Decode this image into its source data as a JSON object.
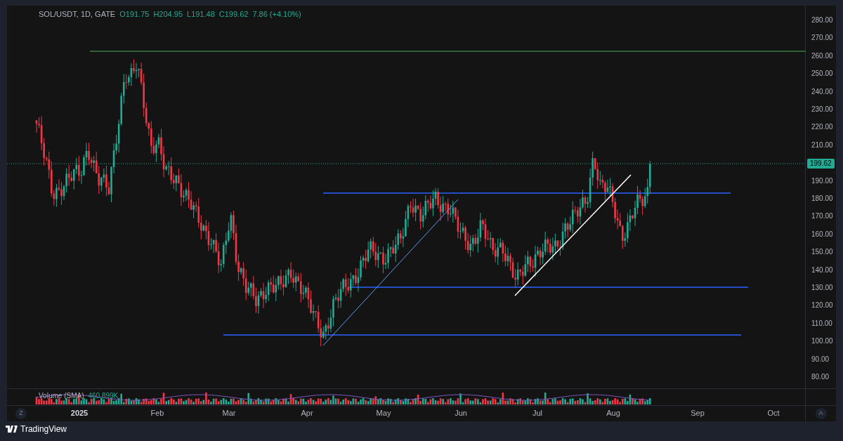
{
  "legend": {
    "symbol": "SOL/USDT, 1D, GATE",
    "open": "O191.75",
    "high": "H204.95",
    "low": "L191.48",
    "close": "C199.62",
    "change": "7.86 (+4.10%)"
  },
  "price_axis": {
    "labels": [
      "280.00",
      "270.00",
      "260.00",
      "250.00",
      "240.00",
      "230.00",
      "220.00",
      "210.00",
      "190.00",
      "180.00",
      "170.00",
      "160.00",
      "150.00",
      "140.00",
      "130.00",
      "120.00",
      "110.00",
      "100.00",
      "90.00",
      "80.00"
    ],
    "last_price": "199.62"
  },
  "volume_pane": {
    "title": "Volume (SMA)",
    "value": "460.899K"
  },
  "time_axis": {
    "labels": [
      "2025",
      "Feb",
      "Mar",
      "Apr",
      "May",
      "Jun",
      "Jul",
      "Aug",
      "Sep",
      "Oct"
    ]
  },
  "scale_buttons": [
    {
      "label": "Z"
    },
    {
      "label": "A"
    }
  ],
  "brand": {
    "name": "TradingView"
  }
}
